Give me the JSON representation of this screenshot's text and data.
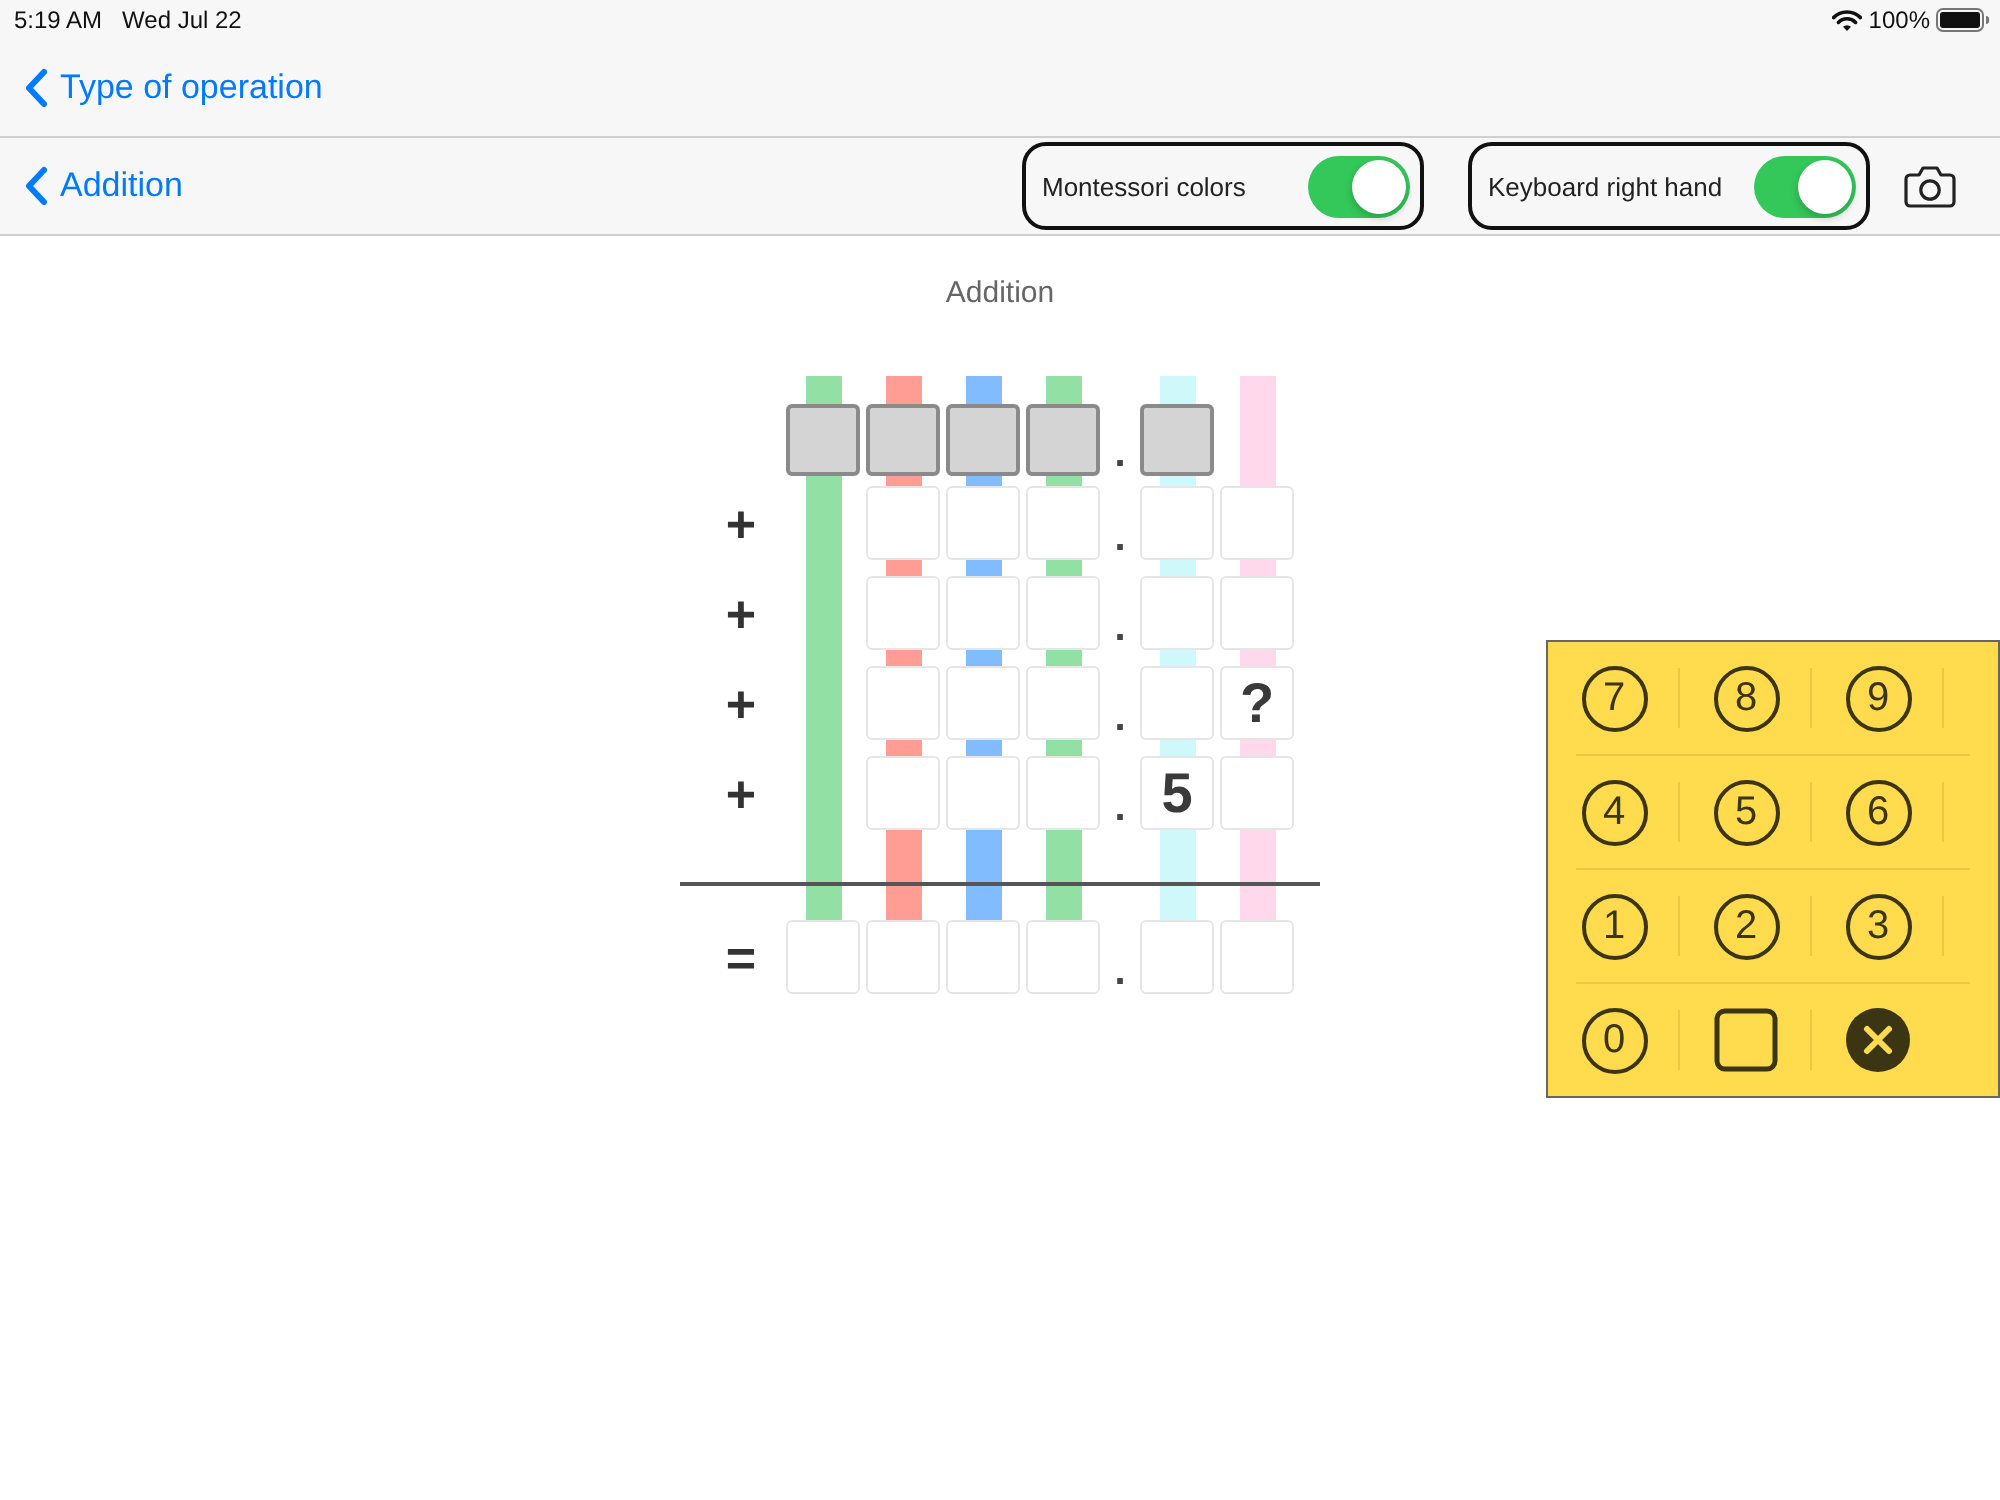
{
  "status_bar": {
    "time": "5:19 AM",
    "date": "Wed Jul 22",
    "battery": "100%"
  },
  "nav_bar": {
    "back_label": "Type of operation"
  },
  "toolbar": {
    "back_label": "Addition",
    "toggles": [
      {
        "label": "Montessori colors",
        "on": true
      },
      {
        "label": "Keyboard right hand",
        "on": true
      }
    ]
  },
  "worksheet": {
    "title": "Addition",
    "columns": [
      {
        "color": "#92e0a4"
      },
      {
        "color": "#ff9c94"
      },
      {
        "color": "#80bcff"
      },
      {
        "color": "#92e0a4"
      },
      {
        "color": "#cff8fb"
      },
      {
        "color": "#ffd8ec"
      }
    ],
    "rows": [
      {
        "point": ".",
        "cells": [
          {
            "kind": "shaded"
          },
          {
            "kind": "shaded"
          },
          {
            "kind": "shaded"
          },
          {
            "kind": "shaded"
          },
          {
            "kind": "shaded"
          },
          null
        ]
      },
      {
        "sign": "+",
        "point": ".",
        "cells": [
          null,
          {
            "kind": "blank"
          },
          {
            "kind": "blank"
          },
          {
            "kind": "blank"
          },
          {
            "kind": "blank"
          },
          {
            "kind": "blank"
          }
        ]
      },
      {
        "sign": "+",
        "point": ".",
        "cells": [
          null,
          {
            "kind": "blank"
          },
          {
            "kind": "blank"
          },
          {
            "kind": "blank"
          },
          {
            "kind": "blank"
          },
          {
            "kind": "blank"
          }
        ]
      },
      {
        "sign": "+",
        "point": ".",
        "cells": [
          null,
          {
            "kind": "blank"
          },
          {
            "kind": "blank"
          },
          {
            "kind": "blank"
          },
          {
            "kind": "blank"
          },
          {
            "kind": "blank",
            "value": "?"
          }
        ]
      },
      {
        "sign": "+",
        "point": ".",
        "cells": [
          null,
          {
            "kind": "blank"
          },
          {
            "kind": "blank"
          },
          {
            "kind": "blank"
          },
          {
            "kind": "blank",
            "value": "5"
          },
          {
            "kind": "blank"
          }
        ]
      }
    ],
    "result": {
      "sign": "=",
      "point": ".",
      "cells": [
        {
          "kind": "blank"
        },
        {
          "kind": "blank"
        },
        {
          "kind": "blank"
        },
        {
          "kind": "blank"
        },
        {
          "kind": "blank"
        },
        {
          "kind": "blank"
        }
      ]
    }
  },
  "keypad": {
    "rows": [
      [
        {
          "kind": "digit",
          "label": "7"
        },
        {
          "kind": "digit",
          "label": "8"
        },
        {
          "kind": "digit",
          "label": "9"
        }
      ],
      [
        {
          "kind": "digit",
          "label": "4"
        },
        {
          "kind": "digit",
          "label": "5"
        },
        {
          "kind": "digit",
          "label": "6"
        }
      ],
      [
        {
          "kind": "digit",
          "label": "1"
        },
        {
          "kind": "digit",
          "label": "2"
        },
        {
          "kind": "digit",
          "label": "3"
        }
      ],
      [
        {
          "kind": "digit",
          "label": "0"
        },
        {
          "kind": "square"
        },
        {
          "kind": "clear"
        }
      ]
    ]
  }
}
